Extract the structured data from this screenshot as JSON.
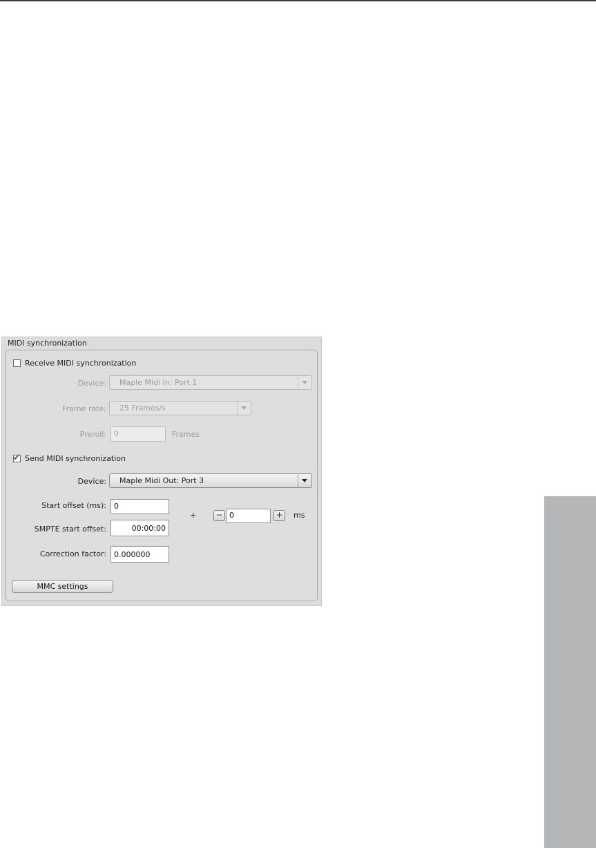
{
  "panel": {
    "title": "MIDI synchronization",
    "receive": {
      "label": "Receive MIDI synchronization",
      "checked": false,
      "device_label": "Device:",
      "device_value": "Maple Midi In: Port 1",
      "frame_rate_label": "Frame rate:",
      "frame_rate_value": "25 Frames/s",
      "preroll_label": "Preroll:",
      "preroll_value": "0",
      "preroll_unit": "Frames"
    },
    "send": {
      "label": "Send MIDI synchronization",
      "checked": true,
      "device_label": "Device:",
      "device_value": "Maple Midi Out: Port 3",
      "start_offset_label": "Start offset (ms):",
      "start_offset_value": "0",
      "smpte_label": "SMPTE start offset:",
      "smpte_value": "00:00:00",
      "plus_sign": "+",
      "spin_minus": "−",
      "spin_value": "0",
      "spin_plus": "+",
      "ms_unit": "ms",
      "correction_label": "Correction factor:",
      "correction_value": "0.000000"
    },
    "mmc_button": "MMC settings"
  },
  "colors": {
    "side_tab": "#b5b6b8",
    "panel_bg": "#dcdcdc",
    "check_accent": "#2a4f80"
  }
}
